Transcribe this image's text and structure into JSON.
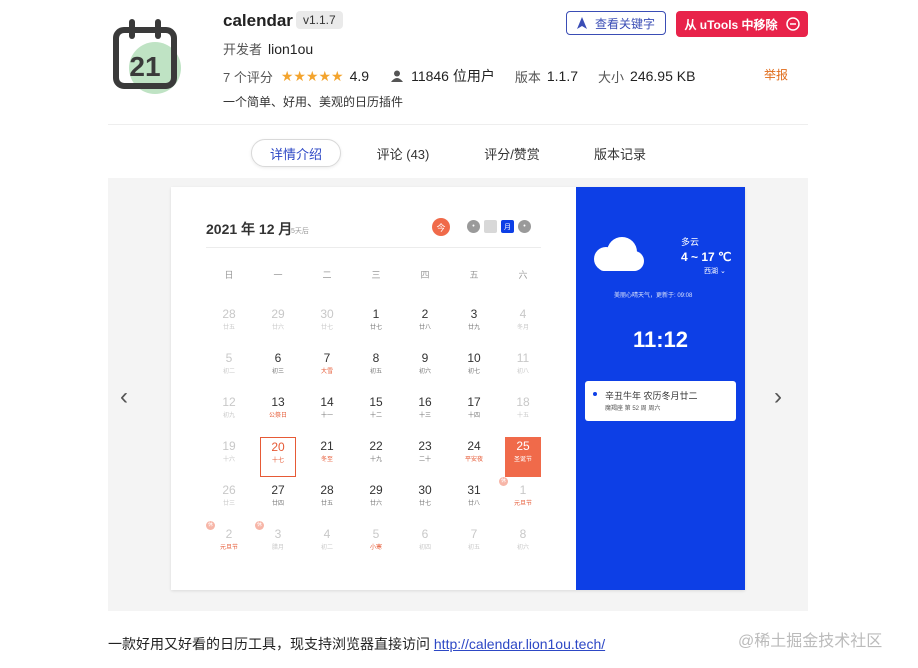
{
  "header": {
    "title": "calendar",
    "version": "v1.1.7",
    "developer_label": "开发者",
    "developer": "lion1ou",
    "ratings_count": "7 个评分",
    "stars": "★★★★★",
    "score": "4.9",
    "users": "11846 位用户",
    "version_label": "版本",
    "version_value": "1.1.7",
    "size_label": "大小",
    "size_value": "246.95 KB",
    "description": "一个简单、好用、美观的日历插件",
    "keywords_button": "查看关键字",
    "remove_button": "从 uTools 中移除",
    "report": "举报",
    "icon_number": "21"
  },
  "tabs": [
    {
      "label": "详情介绍"
    },
    {
      "label": "评论 (43)"
    },
    {
      "label": "评分/赞赏"
    },
    {
      "label": "版本记录"
    }
  ],
  "gallery": {
    "prev": "‹",
    "next": "›",
    "calendar": {
      "title": "2021 年 12 月",
      "subtitle": "5天后",
      "today_btn": "今",
      "view_label": "月",
      "weekdays": [
        "日",
        "一",
        "二",
        "三",
        "四",
        "五",
        "六"
      ],
      "days": [
        {
          "n": "28",
          "l": "廿五",
          "cls": "other"
        },
        {
          "n": "29",
          "l": "廿六",
          "cls": "other"
        },
        {
          "n": "30",
          "l": "廿七",
          "cls": "other"
        },
        {
          "n": "1",
          "l": "廿七",
          "cls": ""
        },
        {
          "n": "2",
          "l": "廿八",
          "cls": ""
        },
        {
          "n": "3",
          "l": "廿九",
          "cls": ""
        },
        {
          "n": "4",
          "l": "冬月",
          "cls": "other"
        },
        {
          "n": "5",
          "l": "初二",
          "cls": "other"
        },
        {
          "n": "6",
          "l": "初三",
          "cls": ""
        },
        {
          "n": "7",
          "l": "大雪",
          "cls": "red-l"
        },
        {
          "n": "8",
          "l": "初五",
          "cls": ""
        },
        {
          "n": "9",
          "l": "初六",
          "cls": ""
        },
        {
          "n": "10",
          "l": "初七",
          "cls": ""
        },
        {
          "n": "11",
          "l": "初八",
          "cls": "other"
        },
        {
          "n": "12",
          "l": "初九",
          "cls": "other"
        },
        {
          "n": "13",
          "l": "公祭日",
          "cls": "red-l"
        },
        {
          "n": "14",
          "l": "十一",
          "cls": ""
        },
        {
          "n": "15",
          "l": "十二",
          "cls": ""
        },
        {
          "n": "16",
          "l": "十三",
          "cls": ""
        },
        {
          "n": "17",
          "l": "十四",
          "cls": ""
        },
        {
          "n": "18",
          "l": "十五",
          "cls": "other"
        },
        {
          "n": "19",
          "l": "十六",
          "cls": "other"
        },
        {
          "n": "20",
          "l": "十七",
          "cls": "selected red-n red-l"
        },
        {
          "n": "21",
          "l": "冬至",
          "cls": "red-l"
        },
        {
          "n": "22",
          "l": "十九",
          "cls": ""
        },
        {
          "n": "23",
          "l": "二十",
          "cls": ""
        },
        {
          "n": "24",
          "l": "平安夜",
          "cls": "red-l"
        },
        {
          "n": "25",
          "l": "圣诞节",
          "cls": "hl"
        },
        {
          "n": "26",
          "l": "廿三",
          "cls": "other"
        },
        {
          "n": "27",
          "l": "廿四",
          "cls": ""
        },
        {
          "n": "28",
          "l": "廿五",
          "cls": ""
        },
        {
          "n": "29",
          "l": "廿六",
          "cls": ""
        },
        {
          "n": "30",
          "l": "廿七",
          "cls": ""
        },
        {
          "n": "31",
          "l": "廿八",
          "cls": ""
        },
        {
          "n": "1",
          "l": "元旦节",
          "cls": "other red-l"
        },
        {
          "n": "2",
          "l": "元旦节",
          "cls": "other red-l"
        },
        {
          "n": "3",
          "l": "腊月",
          "cls": "other"
        },
        {
          "n": "4",
          "l": "初二",
          "cls": "other"
        },
        {
          "n": "5",
          "l": "小寒",
          "cls": "other red-l"
        },
        {
          "n": "6",
          "l": "初四",
          "cls": "other"
        },
        {
          "n": "7",
          "l": "初五",
          "cls": "other"
        },
        {
          "n": "8",
          "l": "初六",
          "cls": "other"
        }
      ],
      "rest_label": "休"
    },
    "weather": {
      "desc": "多云",
      "temp": "4 ~ 17 ℃",
      "location": "西湖 ⌄",
      "update": "美丽心晴天气，更新于: 09:08",
      "time": "11:12",
      "lunar": "辛丑牛年  农历冬月廿二",
      "week": "魔羯座  第 52 周  周六"
    }
  },
  "footer": {
    "text": "一款好用又好看的日历工具，现支持浏览器直接访问 ",
    "link": "http://calendar.lion1ou.tech/"
  },
  "watermark": "@稀土掘金技术社区",
  "colors": {
    "accent": "#2d48c5",
    "danger": "#e8234a",
    "panel": "#0d3fe6",
    "highlight": "#f06a4a",
    "star": "#f3a42e"
  }
}
